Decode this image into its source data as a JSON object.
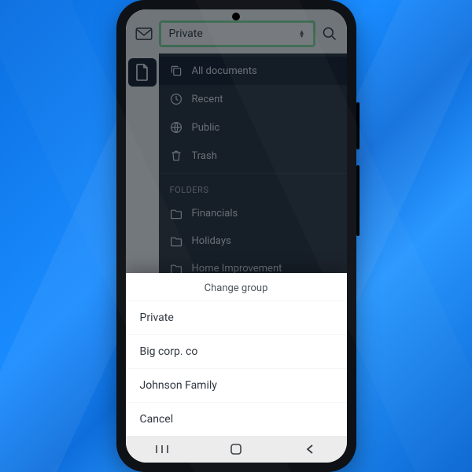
{
  "group_selector": {
    "selected": "Private"
  },
  "sidebar": {
    "items": [
      {
        "icon": "copy-icon",
        "label": "All documents",
        "active": true
      },
      {
        "icon": "clock-icon",
        "label": "Recent"
      },
      {
        "icon": "globe-icon",
        "label": "Public"
      },
      {
        "icon": "trash-icon",
        "label": "Trash"
      }
    ],
    "folders_label": "FOLDERS",
    "folders": [
      {
        "label": "Financials"
      },
      {
        "label": "Holidays"
      },
      {
        "label": "Home Improvement"
      }
    ]
  },
  "sheet": {
    "title": "Change group",
    "options": [
      {
        "label": "Private"
      },
      {
        "label": "Big corp. co"
      },
      {
        "label": "Johnson Family"
      }
    ],
    "cancel": "Cancel"
  }
}
